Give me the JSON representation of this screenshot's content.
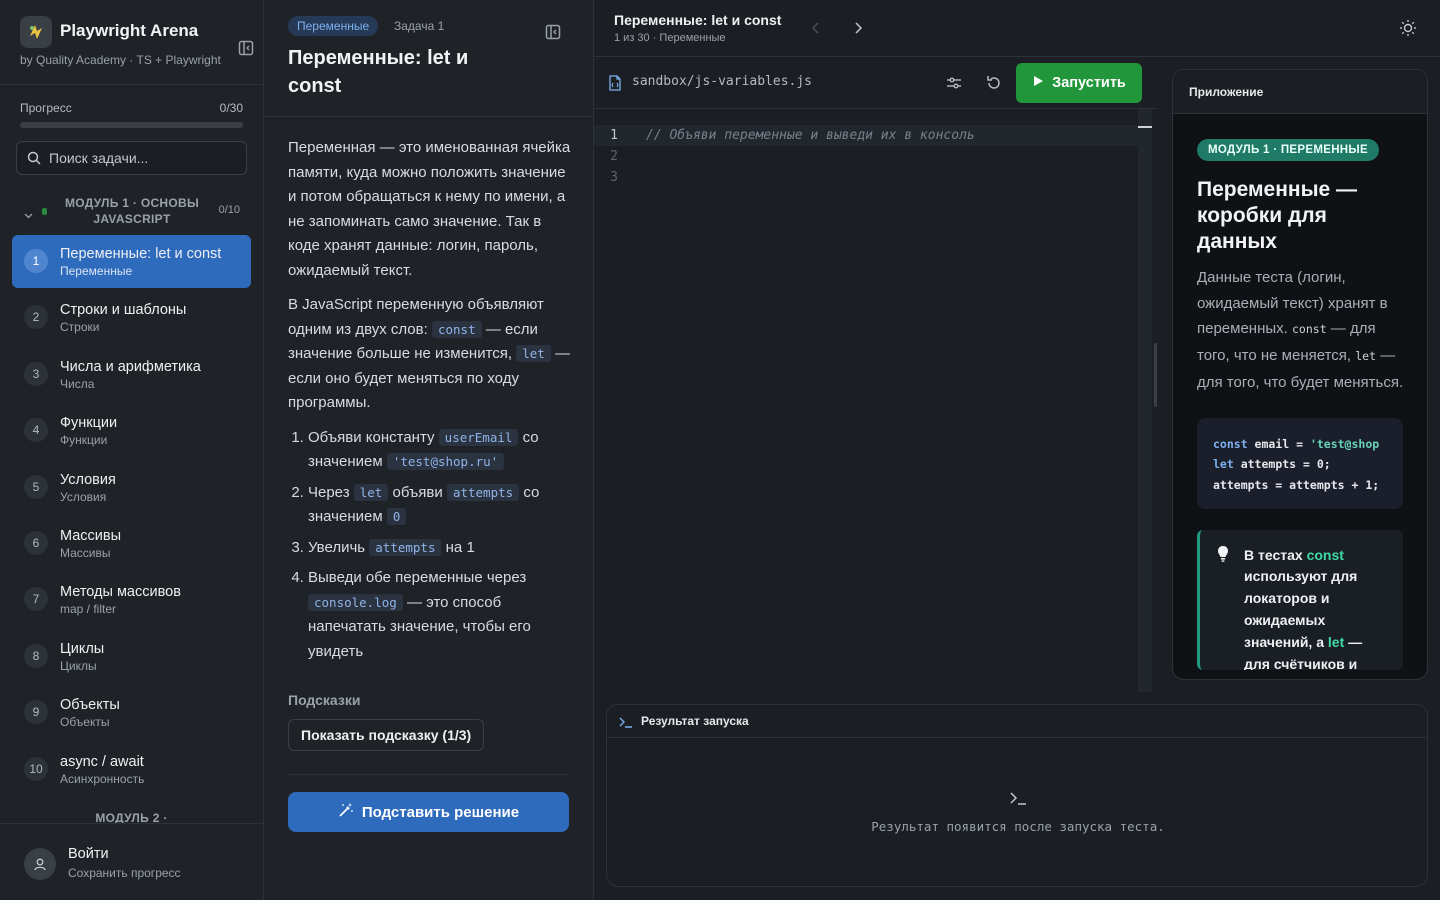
{
  "sidebar": {
    "brand_title": "Playwright Arena",
    "brand_subtitle": "by Quality Academy · TS + Playwright",
    "progress_label": "Прогресс",
    "progress_count": "0/30",
    "progress_fraction": 0,
    "search_placeholder": "Поиск задачи...",
    "module1_title": "МОДУЛЬ 1 · ОСНОВЫ JAVASCRIPT",
    "module1_count": "0/10",
    "tasks": [
      {
        "num": "1",
        "title": "Переменные: let и const",
        "subtitle": "Переменные"
      },
      {
        "num": "2",
        "title": "Строки и шаблоны",
        "subtitle": "Строки"
      },
      {
        "num": "3",
        "title": "Числа и арифметика",
        "subtitle": "Числа"
      },
      {
        "num": "4",
        "title": "Функции",
        "subtitle": "Функции"
      },
      {
        "num": "5",
        "title": "Условия",
        "subtitle": "Условия"
      },
      {
        "num": "6",
        "title": "Массивы",
        "subtitle": "Массивы"
      },
      {
        "num": "7",
        "title": "Методы массивов",
        "subtitle": "map / filter"
      },
      {
        "num": "8",
        "title": "Циклы",
        "subtitle": "Циклы"
      },
      {
        "num": "9",
        "title": "Объекты",
        "subtitle": "Объекты"
      },
      {
        "num": "10",
        "title": "async / await",
        "subtitle": "Асинхронность"
      }
    ],
    "module2_title": "МОДУЛЬ 2 ·",
    "login_title": "Войти",
    "login_subtitle": "Сохранить прогресс"
  },
  "task_panel": {
    "module_badge": "Переменные",
    "task_number": "Задача 1",
    "title": "Переменные: let и const",
    "para1": "Переменная — это именованная ячейка памяти, куда можно положить значение и потом обращаться к нему по имени, а не запоминать само значение. Так в коде хранят данные: логин, пароль, ожидаемый текст.",
    "para2_a": "В JavaScript переменную объявляют одним из двух слов: ",
    "para2_code1": "const",
    "para2_b": " — если значение больше не изменится, ",
    "para2_code2": "let",
    "para2_c": " — если оно будет меняться по ходу программы.",
    "steps": [
      {
        "a": "Объяви константу ",
        "c1": "userEmail",
        "b": " со значением ",
        "c2": "'test@shop.ru'",
        "c": ""
      },
      {
        "a": "Через ",
        "c1": "let",
        "b": " объяви ",
        "c2": "attempts",
        "c": " со значением ",
        "c3": "0"
      },
      {
        "a": "Увеличь ",
        "c1": "attempts",
        "b": " на 1"
      },
      {
        "a": "Выведи обе переменные через ",
        "c1": "console.log",
        "b": " — это способ напечатать значение, чтобы его увидеть"
      }
    ],
    "hints_label": "Подсказки",
    "hint_button": "Показать подсказку (1/3)",
    "solve_button": "Подставить решение"
  },
  "topbar": {
    "title": "Переменные: let и const",
    "subtitle": "1 из 30 · Переменные"
  },
  "editor": {
    "file_name": "sandbox/js-variables.js",
    "run_button": "Запустить",
    "lines": [
      {
        "n": "1",
        "text": "// Объяви переменные и выведи их в консоль"
      },
      {
        "n": "2",
        "text": ""
      },
      {
        "n": "3",
        "text": ""
      }
    ]
  },
  "preview": {
    "header": "Приложение",
    "module_badge": "МОДУЛЬ 1 · ПЕРЕМЕННЫЕ",
    "title": "Переменные — коробки для данных",
    "desc_a": "Данные теста (логин, ожидаемый текст) хранят в переменных. ",
    "desc_code1": "const",
    "desc_b": " — для того, что не меняется, ",
    "desc_code2": "let",
    "desc_c": " — для того, что будет меняться.",
    "code_line1_kw": "const",
    "code_line1_rest": " email = ",
    "code_line1_str": "'test@shop",
    "code_line2_kw": "let",
    "code_line2_rest": " attempts = 0;",
    "code_line3": "attempts = attempts + 1;",
    "tip_a": "В тестах ",
    "tip_hl1": "const",
    "tip_b": " используют для локаторов и ожидаемых значений, а ",
    "tip_hl2": "let",
    "tip_c": " — для счётчиков и"
  },
  "results": {
    "header": "Результат запуска",
    "empty_text": "Результат появится после запуска теста."
  },
  "colors": {
    "accent_blue": "#2f6bbd",
    "run_green": "#22963a",
    "teal": "#1f7a66"
  }
}
